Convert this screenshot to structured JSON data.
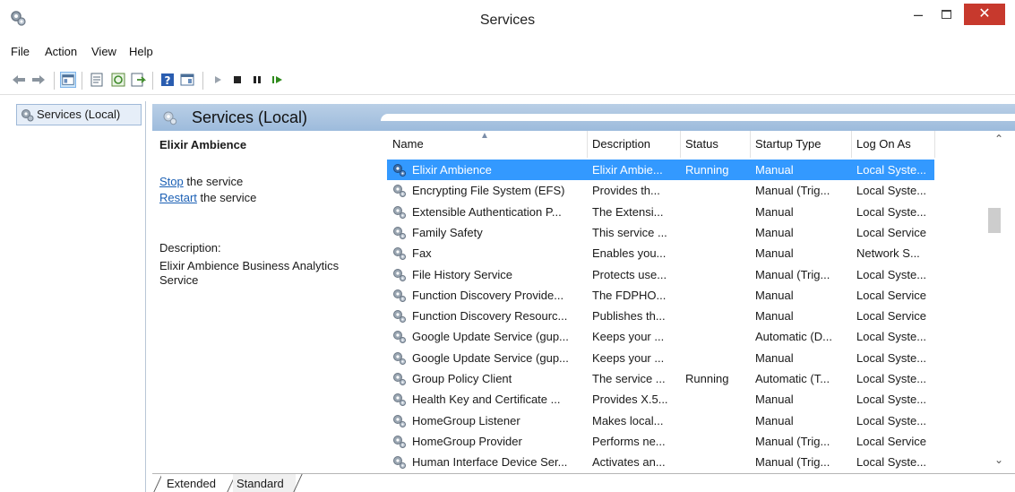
{
  "window": {
    "title": "Services",
    "minimize_glyph": "–",
    "close_glyph": "✕"
  },
  "menu": [
    "File",
    "Action",
    "View",
    "Help"
  ],
  "tree": {
    "root": "Services (Local)"
  },
  "content_header": {
    "title": "Services (Local)"
  },
  "details": {
    "service_name": "Elixir Ambience",
    "stop_link": "Stop",
    "stop_suffix": " the service",
    "restart_link": "Restart",
    "restart_suffix": " the service",
    "description_label": "Description:",
    "description_text": "Elixir Ambience Business Analytics Service"
  },
  "columns": [
    "Name",
    "Description",
    "Status",
    "Startup Type",
    "Log On As"
  ],
  "rows": [
    {
      "name": "Elixir Ambience",
      "description": "Elixir Ambie...",
      "status": "Running",
      "startup": "Manual",
      "logon": "Local Syste..."
    },
    {
      "name": "Encrypting File System (EFS)",
      "description": "Provides th...",
      "status": "",
      "startup": "Manual (Trig...",
      "logon": "Local Syste..."
    },
    {
      "name": "Extensible Authentication P...",
      "description": "The Extensi...",
      "status": "",
      "startup": "Manual",
      "logon": "Local Syste..."
    },
    {
      "name": "Family Safety",
      "description": "This service ...",
      "status": "",
      "startup": "Manual",
      "logon": "Local Service"
    },
    {
      "name": "Fax",
      "description": "Enables you...",
      "status": "",
      "startup": "Manual",
      "logon": "Network S..."
    },
    {
      "name": "File History Service",
      "description": "Protects use...",
      "status": "",
      "startup": "Manual (Trig...",
      "logon": "Local Syste..."
    },
    {
      "name": "Function Discovery Provide...",
      "description": "The FDPHO...",
      "status": "",
      "startup": "Manual",
      "logon": "Local Service"
    },
    {
      "name": "Function Discovery Resourc...",
      "description": "Publishes th...",
      "status": "",
      "startup": "Manual",
      "logon": "Local Service"
    },
    {
      "name": "Google Update Service (gup...",
      "description": "Keeps your ...",
      "status": "",
      "startup": "Automatic (D...",
      "logon": "Local Syste..."
    },
    {
      "name": "Google Update Service (gup...",
      "description": "Keeps your ...",
      "status": "",
      "startup": "Manual",
      "logon": "Local Syste..."
    },
    {
      "name": "Group Policy Client",
      "description": "The service ...",
      "status": "Running",
      "startup": "Automatic (T...",
      "logon": "Local Syste..."
    },
    {
      "name": "Health Key and Certificate ...",
      "description": "Provides X.5...",
      "status": "",
      "startup": "Manual",
      "logon": "Local Syste..."
    },
    {
      "name": "HomeGroup Listener",
      "description": "Makes local...",
      "status": "",
      "startup": "Manual",
      "logon": "Local Syste..."
    },
    {
      "name": "HomeGroup Provider",
      "description": "Performs ne...",
      "status": "",
      "startup": "Manual (Trig...",
      "logon": "Local Service"
    },
    {
      "name": "Human Interface Device Ser...",
      "description": "Activates an...",
      "status": "",
      "startup": "Manual (Trig...",
      "logon": "Local Syste..."
    }
  ],
  "selected_row": 0,
  "tabs": [
    "Extended",
    "Standard"
  ],
  "colors": {
    "selection": "#3399ff",
    "header_band": "#9dbbdc",
    "close_button": "#c7392d",
    "link": "#1a5fb4"
  }
}
